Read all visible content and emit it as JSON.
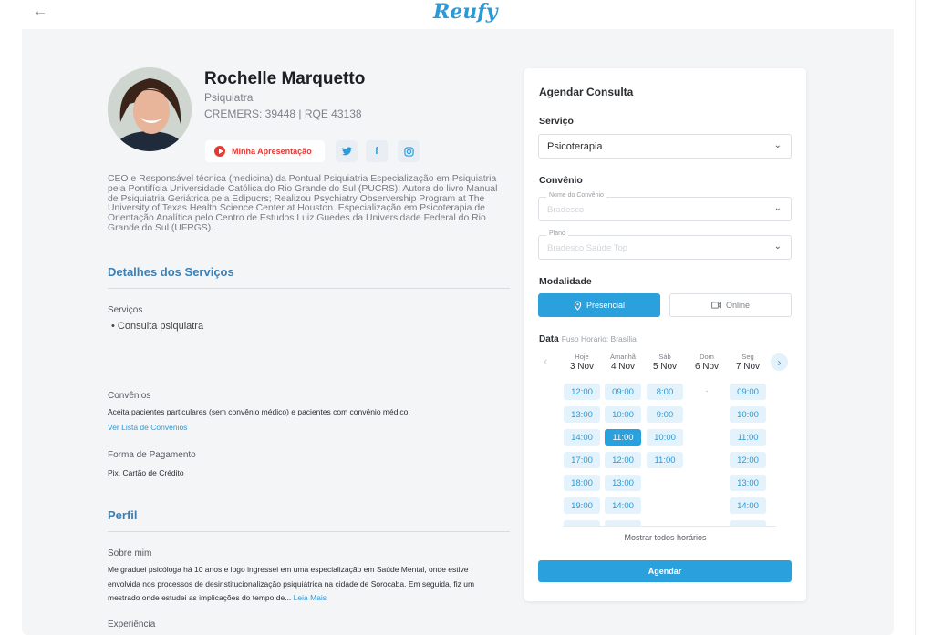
{
  "header": {
    "logo": "Reufy",
    "back_icon": "arrow-left-icon"
  },
  "profile": {
    "name": "Rochelle Marquetto",
    "specialty": "Psiquiatra",
    "registry": "CREMERS: 39448 | RQE 43138",
    "video_label": "Minha Apresentação",
    "social": [
      "twitter-icon",
      "facebook-icon",
      "instagram-icon"
    ],
    "bio": "CEO e Responsável técnica (medicina) da Pontual Psiquiatria Especialização em Psiquiatria pela Pontifícia Universidade Católica do Rio Grande do Sul (PUCRS); Autora do livro Manual de Psiquiatria Geriátrica pela Edipucrs; Realizou Psychiatry Observership Program at The University of Texas Health Science Center at Houston. Especialização em Psicoterapia de Orientação Analítica pelo Centro de Estudos Luiz Guedes da Universidade Federal do Rio Grande do Sul (UFRGS)."
  },
  "services_section": {
    "title": "Detalhes dos Serviços",
    "services_label": "Serviços",
    "services_item": "Consulta psiquiatra",
    "insurance_label": "Convênios",
    "insurance_text": "Aceita pacientes particulares (sem convênio médico) e pacientes com convênio médico.",
    "insurance_link": "Ver Lista de Convênios",
    "payment_label": "Forma de Pagamento",
    "payment_text": "Pix, Cartão de Crédito"
  },
  "profile_section": {
    "title": "Perfil",
    "about_label": "Sobre mim",
    "about_text": "Me graduei psicóloga há 10 anos e logo ingressei em uma especialização em Saúde Mental, onde estive envolvida nos processos de desinstitucionalização psiquiátrica na cidade de Sorocaba. Em seguida, fiz um mestrado onde estudei as implicações do tempo de...",
    "read_more": "Leia Mais",
    "experience_label": "Experiência"
  },
  "booking": {
    "title": "Agendar Consulta",
    "service_label": "Serviço",
    "service_value": "Psicoterapia",
    "insurance_label": "Convênio",
    "insurance_name_label": "Nome do Convênio",
    "insurance_name_value": "Bradesco",
    "plan_label": "Plano",
    "plan_value": "Bradesco Saúde Top",
    "modality_label": "Modalidade",
    "modality_in_person": "Presencial",
    "modality_online": "Online",
    "date_label": "Data",
    "timezone": "Fuso Horário: Brasília",
    "days": [
      {
        "name": "Hoje",
        "date": "3 Nov",
        "slots": [
          "12:00",
          "13:00",
          "14:00",
          "17:00",
          "18:00",
          "19:00"
        ]
      },
      {
        "name": "Amanhã",
        "date": "4 Nov",
        "slots": [
          "09:00",
          "10:00",
          "11:00",
          "12:00",
          "13:00",
          "14:00"
        ]
      },
      {
        "name": "Sáb",
        "date": "5 Nov",
        "slots": [
          "8:00",
          "9:00",
          "10:00",
          "11:00"
        ]
      },
      {
        "name": "Dom",
        "date": "6 Nov",
        "slots": [
          "-"
        ]
      },
      {
        "name": "Seg",
        "date": "7 Nov",
        "slots": [
          "09:00",
          "10:00",
          "11:00",
          "12:00",
          "13:00",
          "14:00"
        ]
      }
    ],
    "selected_slot": "4 Nov 11:00",
    "show_all": "Mostrar todos horários",
    "submit": "Agendar"
  },
  "colors": {
    "accent": "#2aa0dc",
    "link": "#3a7fb5",
    "video": "#e53935"
  }
}
